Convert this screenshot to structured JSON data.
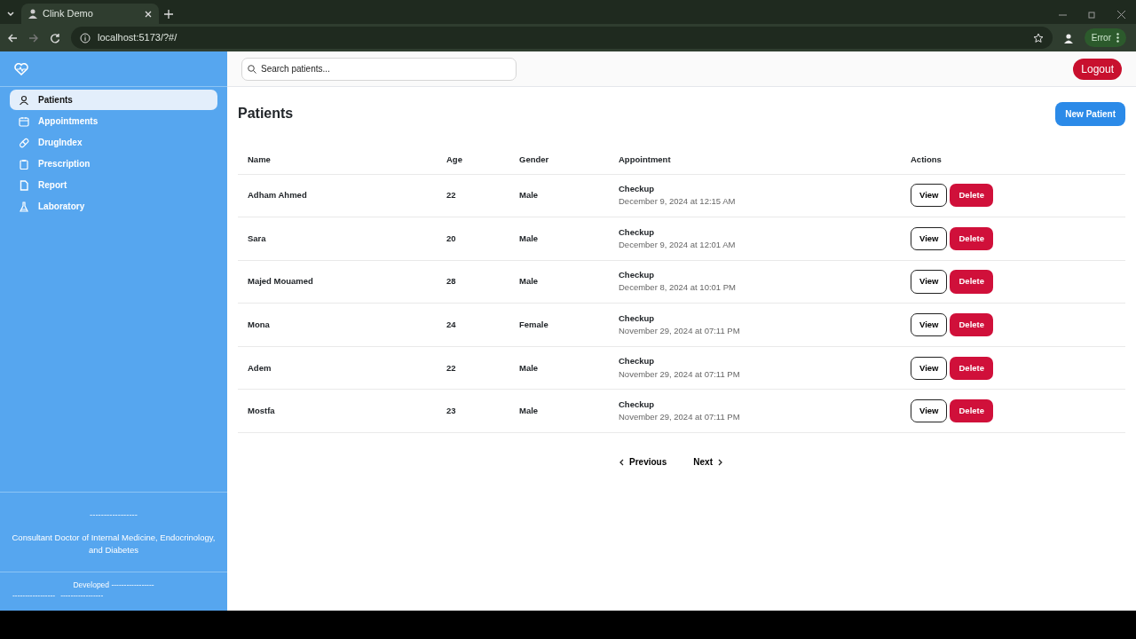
{
  "browser": {
    "tab_title": "Clink Demo",
    "url": "localhost:5173/?#/",
    "profile_status": "Error"
  },
  "sidebar": {
    "items": [
      {
        "label": "Patients",
        "selected": true
      },
      {
        "label": "Appointments",
        "selected": false
      },
      {
        "label": "DrugIndex",
        "selected": false
      },
      {
        "label": "Prescription",
        "selected": false
      },
      {
        "label": "Report",
        "selected": false
      },
      {
        "label": "Laboratory",
        "selected": false
      }
    ],
    "footer": {
      "divider_text": "-----------------",
      "title": "Consultant Doctor of Internal Medicine, Endocrinology, and Diabetes",
      "developed": "Developed -----------------",
      "credits": [
        "-----------------",
        "-----------------"
      ]
    }
  },
  "header": {
    "search": {
      "placeholder": "Search patients..."
    },
    "logout": "Logout"
  },
  "page": {
    "title": "Patients",
    "new_button": "New Patient"
  },
  "table": {
    "columns": [
      "Name",
      "Age",
      "Gender",
      "Appointment",
      "Actions"
    ],
    "rows": [
      {
        "name": "Adham Ahmed",
        "age": "22",
        "gender": "Male",
        "type": "Checkup",
        "date": "December 9, 2024 at 12:15 AM",
        "actions": [
          "View",
          "Delete"
        ]
      },
      {
        "name": "Sara",
        "age": "20",
        "gender": "Male",
        "type": "Checkup",
        "date": "December 9, 2024 at 12:01 AM",
        "actions": [
          "View",
          "Delete"
        ]
      },
      {
        "name": "Majed Mouamed",
        "age": "28",
        "gender": "Male",
        "type": "Checkup",
        "date": "December 8, 2024 at 10:01 PM",
        "actions": [
          "View",
          "Delete"
        ]
      },
      {
        "name": "Mona",
        "age": "24",
        "gender": "Female",
        "type": "Checkup",
        "date": "November 29, 2024 at 07:11 PM",
        "actions": [
          "View",
          "Delete"
        ]
      },
      {
        "name": "Adem",
        "age": "22",
        "gender": "Male",
        "type": "Checkup",
        "date": "November 29, 2024 at 07:11 PM",
        "actions": [
          "View",
          "Delete"
        ]
      },
      {
        "name": "Mostfa",
        "age": "23",
        "gender": "Male",
        "type": "Checkup",
        "date": "November 29, 2024 at 07:11 PM",
        "actions": [
          "View",
          "Delete"
        ]
      }
    ]
  },
  "pagination": {
    "previous": "Previous",
    "next": "Next"
  }
}
